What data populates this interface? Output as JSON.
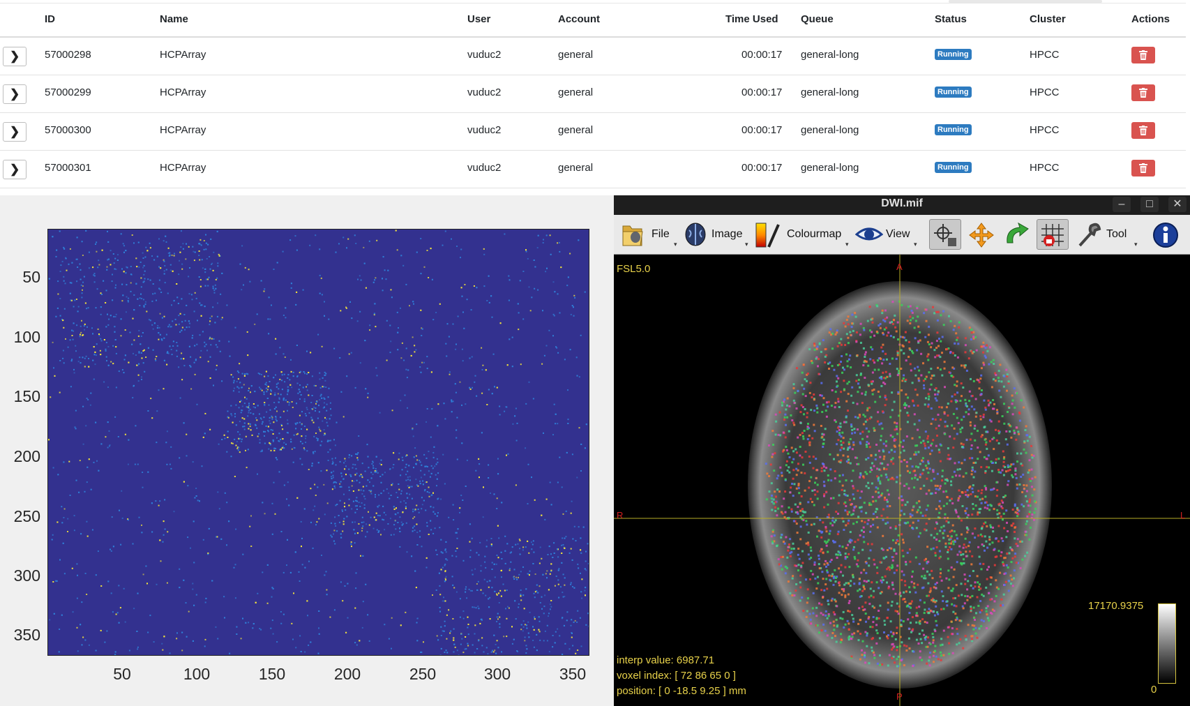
{
  "jobs_table": {
    "columns": [
      "ID",
      "Name",
      "User",
      "Account",
      "Time Used",
      "Queue",
      "Status",
      "Cluster",
      "Actions"
    ],
    "rows": [
      {
        "id": "57000298",
        "name": "HCPArray",
        "user": "vuduc2",
        "account": "general",
        "time_used": "00:00:17",
        "queue": "general-long",
        "status": "Running",
        "cluster": "HPCC"
      },
      {
        "id": "57000299",
        "name": "HCPArray",
        "user": "vuduc2",
        "account": "general",
        "time_used": "00:00:17",
        "queue": "general-long",
        "status": "Running",
        "cluster": "HPCC"
      },
      {
        "id": "57000300",
        "name": "HCPArray",
        "user": "vuduc2",
        "account": "general",
        "time_used": "00:00:17",
        "queue": "general-long",
        "status": "Running",
        "cluster": "HPCC"
      },
      {
        "id": "57000301",
        "name": "HCPArray",
        "user": "vuduc2",
        "account": "general",
        "time_used": "00:00:17",
        "queue": "general-long",
        "status": "Running",
        "cluster": "HPCC"
      }
    ],
    "expand_icon": "chevron-right-icon",
    "delete_icon": "trash-icon",
    "status_color": "#2d7bc0",
    "delete_color": "#d9534f"
  },
  "heatmap": {
    "y_ticks": [
      "50",
      "100",
      "150",
      "200",
      "250",
      "300",
      "350"
    ],
    "x_ticks": [
      "50",
      "100",
      "150",
      "200",
      "250",
      "300",
      "350"
    ],
    "colors": {
      "low": "#33318f",
      "mid": "#2f80d8",
      "high": "#f5e63a"
    }
  },
  "viewer": {
    "window_title": "DWI.mif",
    "window_buttons": [
      "–",
      "□",
      "✕"
    ],
    "toolbar": {
      "file": "File",
      "image": "Image",
      "colourmap": "Colourmap",
      "view": "View",
      "tool": "Tool"
    },
    "toolbar_icons": [
      "folder-icon",
      "brain-icon",
      "colourmap-icon",
      "eye-icon",
      "crosshair-icon",
      "move-icon",
      "rotate-icon",
      "grid-lock-icon",
      "wrench-icon",
      "info-icon"
    ],
    "fsl_label": "FSL5.0",
    "orientation": {
      "top": "A",
      "bottom": "P",
      "left": "R",
      "right": "L"
    },
    "interp_value": "interp value: 6987.71",
    "voxel_index": "voxel index: [ 72 86 65 0 ]",
    "position": "position: [ 0 -18.5 9.25 ] mm",
    "colorbar_max": "17170.9375",
    "colorbar_min": "0",
    "overlay_color": "#e8d24a"
  }
}
